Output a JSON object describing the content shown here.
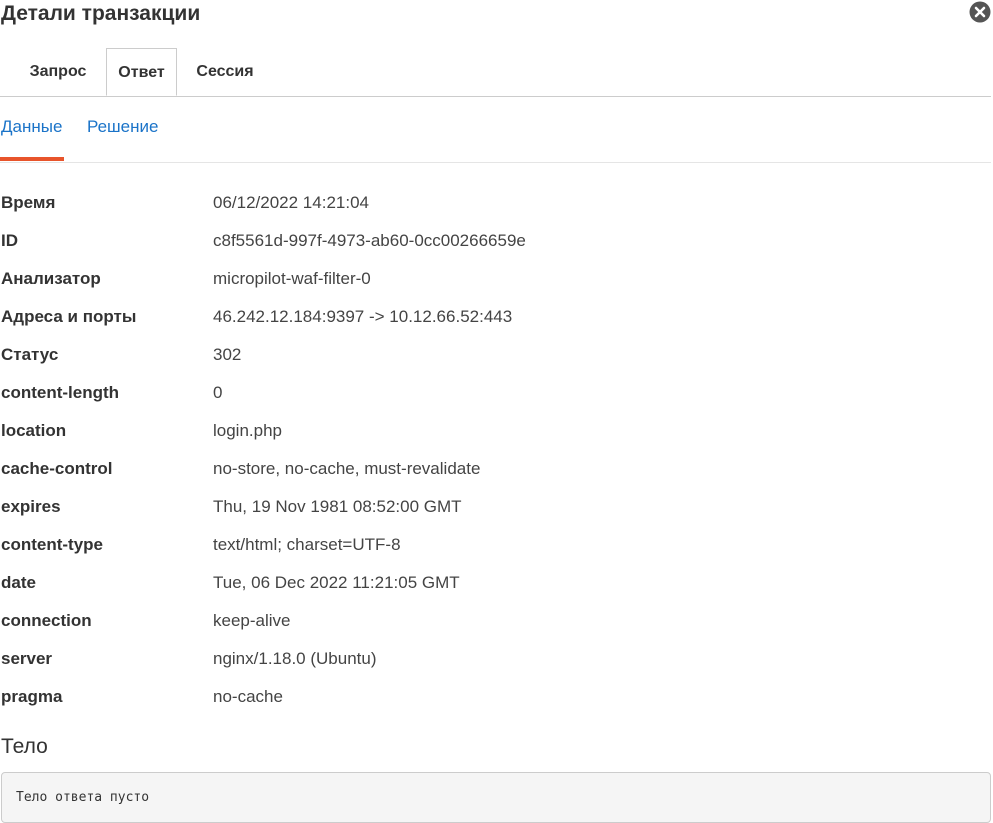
{
  "header": {
    "title": "Детали транзакции",
    "close_icon": "close-circle-icon"
  },
  "tabs": [
    {
      "label": "Запрос",
      "active": false
    },
    {
      "label": "Ответ",
      "active": true
    },
    {
      "label": "Сессия",
      "active": false
    }
  ],
  "subtabs": [
    {
      "label": "Данные",
      "active": true
    },
    {
      "label": "Решение",
      "active": false
    }
  ],
  "details": [
    {
      "key": "Время",
      "value": "06/12/2022 14:21:04"
    },
    {
      "key": "ID",
      "value": "c8f5561d-997f-4973-ab60-0cc00266659e"
    },
    {
      "key": "Анализатор",
      "value": "micropilot-waf-filter-0"
    },
    {
      "key": "Адреса и порты",
      "value": "46.242.12.184:9397 -> 10.12.66.52:443"
    },
    {
      "key": "Статус",
      "value": "302"
    },
    {
      "key": "content-length",
      "value": "0"
    },
    {
      "key": "location",
      "value": "login.php"
    },
    {
      "key": "cache-control",
      "value": "no-store, no-cache, must-revalidate"
    },
    {
      "key": "expires",
      "value": "Thu, 19 Nov 1981 08:52:00 GMT"
    },
    {
      "key": "content-type",
      "value": "text/html; charset=UTF-8"
    },
    {
      "key": "date",
      "value": "Tue, 06 Dec 2022 11:21:05 GMT"
    },
    {
      "key": "connection",
      "value": "keep-alive"
    },
    {
      "key": "server",
      "value": "nginx/1.18.0 (Ubuntu)"
    },
    {
      "key": "pragma",
      "value": "no-cache"
    }
  ],
  "body_section": {
    "heading": "Тело",
    "content": "Тело ответа пусто"
  },
  "colors": {
    "accent_link": "#1a73c8",
    "active_underline": "#e8542b",
    "close_icon": "#555555"
  }
}
